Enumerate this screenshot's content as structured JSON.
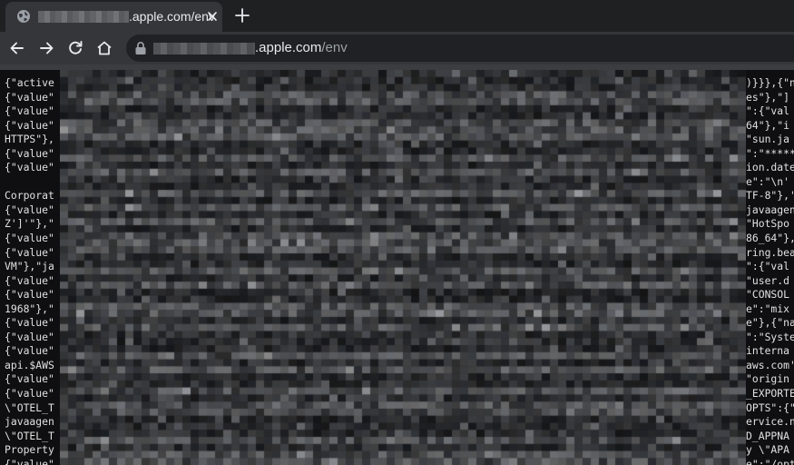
{
  "browser": {
    "tab": {
      "title_visible": ".apple.com/env",
      "favicon": "globe-icon",
      "close_icon": "close-icon"
    },
    "new_tab_icon": "plus-icon",
    "nav": {
      "back_icon": "arrow-left-icon",
      "forward_icon": "arrow-right-icon",
      "reload_icon": "reload-icon",
      "home_icon": "home-icon"
    },
    "address": {
      "lock_icon": "lock-icon",
      "host_visible": ".apple.com",
      "path": "/env"
    }
  },
  "page": {
    "left_lines": [
      "{\"active",
      "{\"value\"",
      "{\"value\"",
      "{\"value\"",
      "HTTPS\"},",
      "{\"value\"",
      "{\"value\"",
      "",
      "Corporat",
      "{\"value\"",
      "Z']'\"},\"",
      "{\"value\"",
      "{\"value\"",
      "VM\"},\"ja",
      "{\"value\"",
      "{\"value\"",
      "1968\"},\"",
      "{\"value\"",
      "{\"value\"",
      "{\"value\"",
      "api.$AWS",
      "{\"value\"",
      "{\"value\"",
      "\\\"OTEL_T",
      "javaagen",
      "\\\"OTEL_T",
      "Property",
      "{\"value\""
    ],
    "right_lines": [
      ")}}},{\"n",
      "es\"},\"]",
      "\":{\"val",
      "64\"},\"i",
      "\"sun.ja",
      "\":\"*****",
      "ion.date",
      "e\":\"\\n'",
      "TF-8\"},'",
      "javaagent",
      "\"HotSpo",
      "86_64\"},",
      "ring.bea",
      "\":{\"val",
      "\"user.d",
      "\"CONSOL",
      "e\":\"mix",
      "e\"},{\"nam",
      "\":\"Syste",
      "interna",
      "aws.com'",
      "\"origin",
      "_EXPORTE",
      "OPTS\":{\"",
      "ervice.n",
      "D_APPNA",
      "y \\\"APA",
      "e\":\"/opt/"
    ]
  },
  "colors": {
    "tab_strip": "#1f2022",
    "tab_active": "#35363a",
    "toolbar": "#35363a",
    "omnibox": "#202124",
    "page_bg": "#0f0f11",
    "text": "#e0e0e0"
  }
}
